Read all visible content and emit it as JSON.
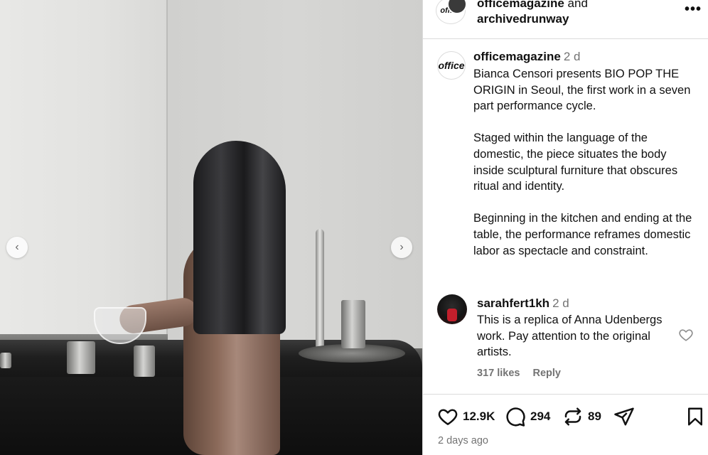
{
  "header": {
    "avatar_label": "office",
    "primary_user": "officemagazine",
    "and_text": " and",
    "collab_user": "archivedrunway",
    "more_label": "•••"
  },
  "media": {
    "prev_arrow": "‹",
    "next_arrow": "›"
  },
  "caption": {
    "avatar_label": "office",
    "username": "officemagazine",
    "timestamp": "2 d",
    "paragraphs": [
      "Bianca Censori presents BIO POP THE ORIGIN in Seoul, the first work in a seven part performance cycle.",
      "Staged within the language of the domestic, the piece situates the body inside sculptural furniture that obscures ritual and identity.",
      "Beginning in the kitchen and ending at the table, the performance reframes domestic labor as spectacle and constraint."
    ]
  },
  "comment": {
    "username": "sarahfert1kh",
    "timestamp": "2 d",
    "text": "This is a replica of Anna Udenbergs work. Pay attention to the original artists.",
    "likes": "317 likes",
    "reply_label": "Reply",
    "heart_icon": "heart-outline-icon"
  },
  "actions": {
    "like_count": "12.9K",
    "comment_count": "294",
    "repost_count": "89",
    "date": "2 days ago"
  },
  "colors": {
    "secondary_text": "#737373",
    "border": "#dbdbdb",
    "text": "#111111"
  }
}
